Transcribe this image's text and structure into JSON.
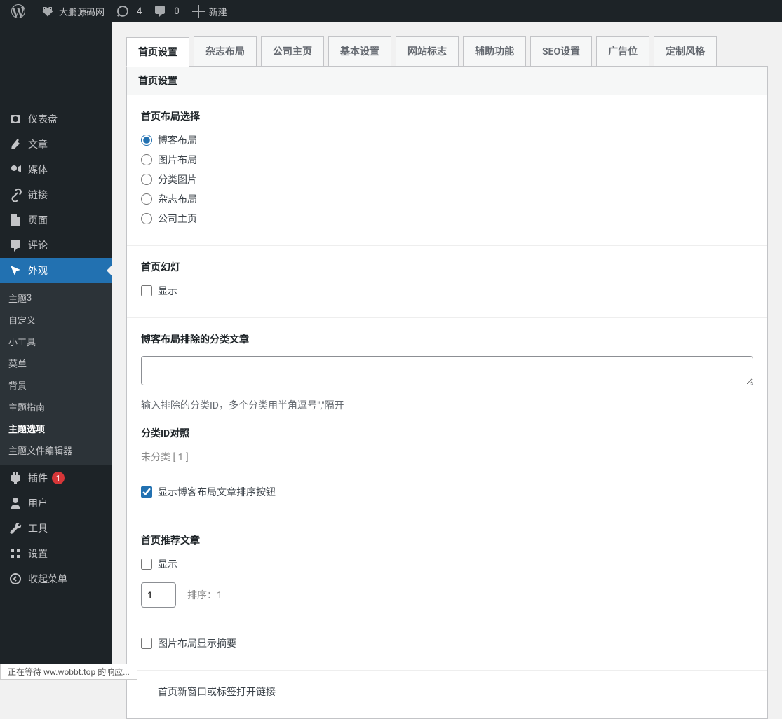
{
  "adminbar": {
    "site_name": "大鹏源码网",
    "updates": "4",
    "comments": "0",
    "new": "新建"
  },
  "sidebar": {
    "dashboard": "仪表盘",
    "posts": "文章",
    "media": "媒体",
    "links": "链接",
    "pages": "页面",
    "comments": "评论",
    "appearance": "外观",
    "appearance_sub": {
      "themes": "主题",
      "themes_badge": "3",
      "customize": "自定义",
      "widgets": "小工具",
      "menus": "菜单",
      "background": "背景",
      "theme_guide": "主题指南",
      "theme_options": "主题选项",
      "theme_file_editor": "主题文件编辑器"
    },
    "plugins": "插件",
    "plugins_badge": "1",
    "users": "用户",
    "tools": "工具",
    "settings": "设置",
    "collapse": "收起菜单"
  },
  "tabs": [
    "首页设置",
    "杂志布局",
    "公司主页",
    "基本设置",
    "网站标志",
    "辅助功能",
    "SEO设置",
    "广告位",
    "定制风格"
  ],
  "panel_title": "首页设置",
  "layout": {
    "title": "首页布局选择",
    "options": [
      "博客布局",
      "图片布局",
      "分类图片",
      "杂志布局",
      "公司主页"
    ]
  },
  "slider": {
    "title": "首页幻灯",
    "show": "显示"
  },
  "exclude": {
    "title": "博客布局排除的分类文章",
    "help": "输入排除的分类ID，多个分类用半角逗号\",\"隔开",
    "id_title": "分类ID对照",
    "id_list": "未分类 [ 1 ]",
    "sort_btn": "显示博客布局文章排序按钮"
  },
  "featured": {
    "title": "首页推荐文章",
    "show": "显示",
    "order_value": "1",
    "order_label": "排序：",
    "order_num": "1"
  },
  "img_layout": {
    "summary": "图片布局显示摘要"
  },
  "new_window": {
    "label": "首页新窗口或标签打开链接"
  },
  "statusbar": "正在等待 ww.wobbt.top 的响应..."
}
